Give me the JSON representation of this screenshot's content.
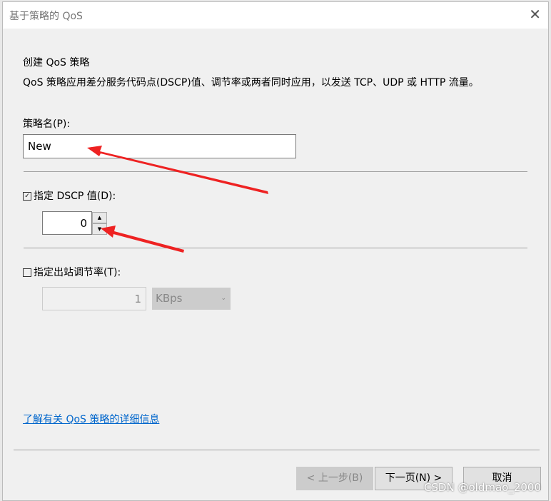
{
  "window": {
    "title": "基于策略的 QoS",
    "close_icon": "close-icon"
  },
  "heading": "创建 QoS 策略",
  "description": "QoS 策略应用差分服务代码点(DSCP)值、调节率或两者同时应用，以发送 TCP、UDP 或 HTTP 流量。",
  "policy_name": {
    "label": "策略名(P):",
    "value": "New"
  },
  "dscp": {
    "label": "指定 DSCP 值(D):",
    "checked": true,
    "value": "0"
  },
  "throttle": {
    "label": "指定出站调节率(T):",
    "checked": false,
    "value": "1",
    "unit": "KBps"
  },
  "link": "了解有关 QoS 策略的详细信息",
  "buttons": {
    "back": "< 上一步(B)",
    "next": "下一页(N) >",
    "cancel": "取消"
  },
  "watermark": "CSDN @oldmao_2000",
  "annotation_color": "#ee2222"
}
